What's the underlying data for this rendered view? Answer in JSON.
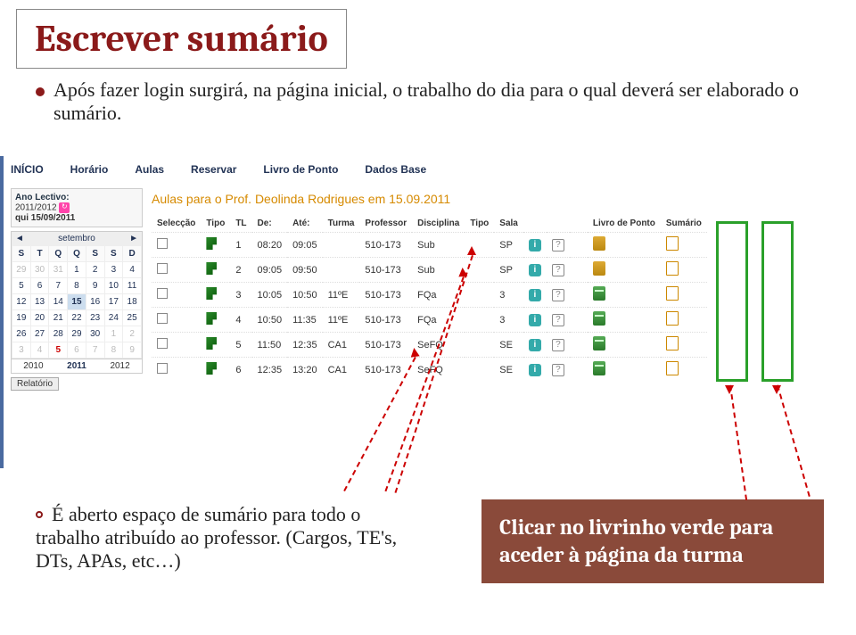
{
  "slide": {
    "title": "Escrever sumário",
    "body_text": "Após fazer login surgirá, na página inicial, o trabalho do dia para o qual  deverá ser elaborado o sumário.",
    "note_left": "É aberto espaço de sumário para todo o trabalho atribuído ao professor. (Cargos, TE's, DTs, APAs, etc…)",
    "callout": "Clicar no livrinho verde para aceder à página da turma"
  },
  "screenshot": {
    "tabs": [
      "INÍCIO",
      "Horário",
      "Aulas",
      "Reservar",
      "Livro de Ponto",
      "Dados Base"
    ],
    "ano": {
      "label": "Ano Lectivo:",
      "value": "2011/2012",
      "date": "qui 15/09/2011"
    },
    "calendar": {
      "month": "setembro",
      "dow": [
        "S",
        "T",
        "Q",
        "Q",
        "S",
        "S",
        "D"
      ],
      "weeks": [
        [
          {
            "d": "29",
            "o": true
          },
          {
            "d": "30",
            "o": true
          },
          {
            "d": "31",
            "o": true
          },
          {
            "d": "1"
          },
          {
            "d": "2"
          },
          {
            "d": "3"
          },
          {
            "d": "4"
          }
        ],
        [
          {
            "d": "5"
          },
          {
            "d": "6"
          },
          {
            "d": "7"
          },
          {
            "d": "8"
          },
          {
            "d": "9"
          },
          {
            "d": "10"
          },
          {
            "d": "11"
          }
        ],
        [
          {
            "d": "12"
          },
          {
            "d": "13"
          },
          {
            "d": "14"
          },
          {
            "d": "15",
            "sel": true
          },
          {
            "d": "16"
          },
          {
            "d": "17"
          },
          {
            "d": "18"
          }
        ],
        [
          {
            "d": "19"
          },
          {
            "d": "20"
          },
          {
            "d": "21"
          },
          {
            "d": "22"
          },
          {
            "d": "23"
          },
          {
            "d": "24"
          },
          {
            "d": "25"
          }
        ],
        [
          {
            "d": "26"
          },
          {
            "d": "27"
          },
          {
            "d": "28"
          },
          {
            "d": "29"
          },
          {
            "d": "30"
          },
          {
            "d": "1",
            "o": true
          },
          {
            "d": "2",
            "o": true
          }
        ],
        [
          {
            "d": "3",
            "o": true
          },
          {
            "d": "4",
            "o": true
          },
          {
            "d": "5",
            "red": true,
            "o": true
          },
          {
            "d": "6",
            "o": true
          },
          {
            "d": "7",
            "o": true
          },
          {
            "d": "8",
            "o": true
          },
          {
            "d": "9",
            "o": true
          }
        ]
      ],
      "years": [
        "2010",
        "2011",
        "2012"
      ],
      "active_year": "2011",
      "relatorio": "Relatório"
    },
    "aulas_title": "Aulas para o Prof. Deolinda Rodrigues em 15.09.2011",
    "columns": [
      "Selecção",
      "Tipo",
      "TL",
      "De:",
      "Até:",
      "Turma",
      "Professor",
      "Disciplina",
      "Tipo",
      "Sala"
    ],
    "lp_header": "Livro de Ponto",
    "sum_header": "Sumário",
    "rows": [
      {
        "tl": "1",
        "de": "08:20",
        "ate": "09:05",
        "turma": "",
        "prof": "510-173",
        "disc": "Sub",
        "tipo": "",
        "sala": "SP"
      },
      {
        "tl": "2",
        "de": "09:05",
        "ate": "09:50",
        "turma": "",
        "prof": "510-173",
        "disc": "Sub",
        "tipo": "",
        "sala": "SP"
      },
      {
        "tl": "3",
        "de": "10:05",
        "ate": "10:50",
        "turma": "11ºE",
        "prof": "510-173",
        "disc": "FQa",
        "tipo": "",
        "sala": "3"
      },
      {
        "tl": "4",
        "de": "10:50",
        "ate": "11:35",
        "turma": "11ºE",
        "prof": "510-173",
        "disc": "FQa",
        "tipo": "",
        "sala": "3"
      },
      {
        "tl": "5",
        "de": "11:50",
        "ate": "12:35",
        "turma": "CA1",
        "prof": "510-173",
        "disc": "SeFQ",
        "tipo": "",
        "sala": "SE"
      },
      {
        "tl": "6",
        "de": "12:35",
        "ate": "13:20",
        "turma": "CA1",
        "prof": "510-173",
        "disc": "SeFQ",
        "tipo": "",
        "sala": "SE"
      }
    ]
  }
}
